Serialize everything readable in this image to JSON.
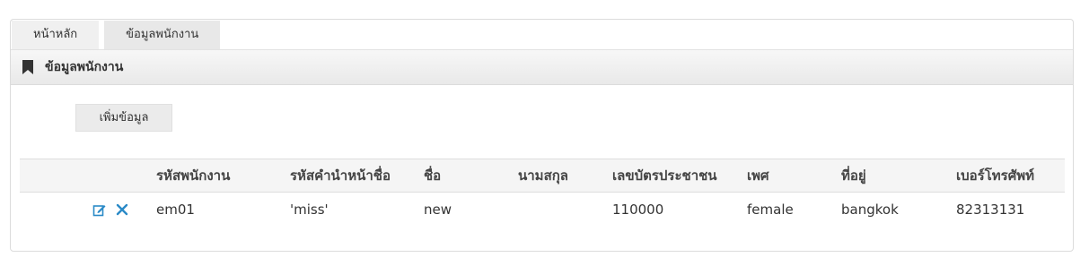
{
  "tabs": [
    {
      "label": "หน้าหลัก"
    },
    {
      "label": "ข้อมูลพนักงาน"
    }
  ],
  "panel": {
    "title": "ข้อมูลพนักงาน",
    "icon": "bookmark-icon"
  },
  "toolbar": {
    "add_label": "เพิ่มข้อมูล"
  },
  "table": {
    "columns": [
      "รหัสพนักงาน",
      "รหัสคำนำหน้าชื่อ",
      "ชื่อ",
      "นามสกุล",
      "เลขบัตรประชาชน",
      "เพศ",
      "ที่อยู่",
      "เบอร์โทรศัพท์"
    ],
    "rows": [
      {
        "cells": [
          "em01",
          "'miss'",
          "new",
          "",
          "110000",
          "female",
          "bangkok",
          "82313131"
        ],
        "actions": {
          "edit_icon": "edit-icon",
          "delete_icon": "delete-icon"
        }
      }
    ]
  },
  "colors": {
    "accent": "#2a8ac7",
    "title_bg": "#ececec",
    "header_bg": "#f5f5f5"
  }
}
